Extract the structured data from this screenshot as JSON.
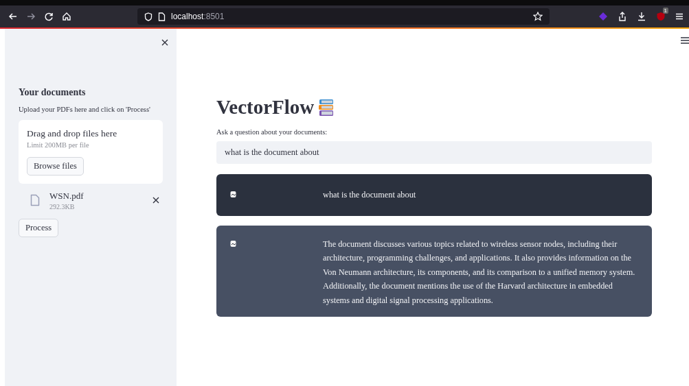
{
  "browser": {
    "url_host": "localhost",
    "url_port": ":8501",
    "notification_badge": "1"
  },
  "sidebar": {
    "heading": "Your documents",
    "description": "Upload your PDFs here and click on 'Process'",
    "uploader": {
      "title": "Drag and drop files here",
      "limit": "Limit 200MB per file",
      "button": "Browse files"
    },
    "files": [
      {
        "name": "WSN.pdf",
        "size": "292.3KB"
      }
    ],
    "process_button": "Process"
  },
  "main": {
    "title": "VectorFlow",
    "question_label": "Ask a question about your documents:",
    "question_value": "what is the document about",
    "messages": [
      {
        "kind": "user",
        "text": "what is the document about"
      },
      {
        "kind": "bot",
        "text": "The document discusses various topics related to wireless sensor nodes, including their architecture, programming challenges, and applications. It also provides information on the Von Neumann architecture, its components, and its comparison to a unified memory system. Additionally, the document mentions the use of the Harvard architecture in embedded systems and digital signal processing applications."
      }
    ]
  }
}
